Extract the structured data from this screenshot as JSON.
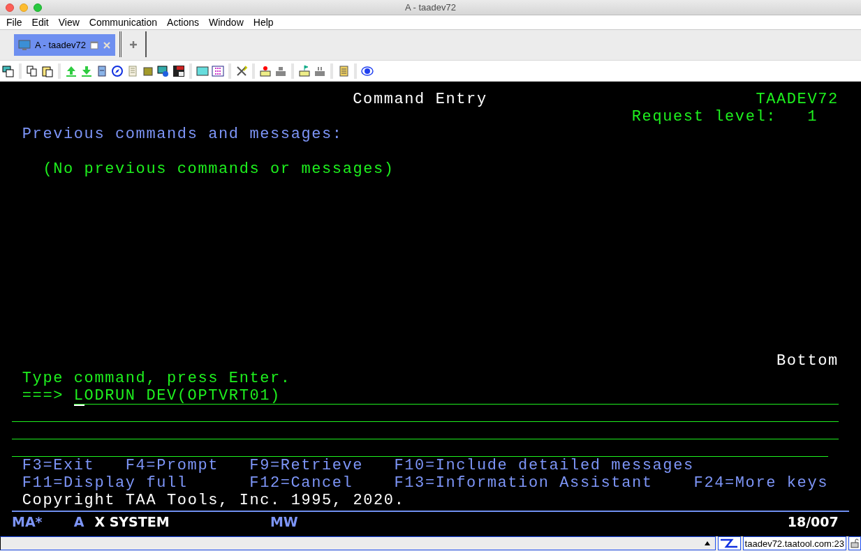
{
  "window": {
    "title": "A - taadev72"
  },
  "menu": [
    "File",
    "Edit",
    "View",
    "Communication",
    "Actions",
    "Window",
    "Help"
  ],
  "tabs": [
    {
      "label": "A - taadev72",
      "selected": true
    }
  ],
  "screen": {
    "title": "Command Entry",
    "system": "TAADEV72",
    "request_level_label": "Request level:",
    "request_level": "1",
    "heading": "Previous commands and messages:",
    "messages": [
      "(No previous commands or messages)"
    ],
    "position": "Bottom",
    "instruction": "Type command, press Enter.",
    "prompt": "===>",
    "command": "LODRUN DEV(OPTVRT01)",
    "function_keys": [
      [
        "F3=Exit",
        "F4=Prompt",
        "F9=Retrieve",
        "F10=Include detailed messages"
      ],
      [
        "F11=Display full",
        "F12=Cancel",
        "F13=Information Assistant",
        "F24=More keys"
      ]
    ],
    "copyright": "Copyright TAA Tools, Inc. 1995, 2020."
  },
  "status_line": {
    "mode": "MA*",
    "session": "A",
    "state": "X SYSTEM",
    "input": "MW",
    "cursor": "18/007"
  },
  "status_bar": {
    "host": "taadev72.taatool.com:23"
  }
}
